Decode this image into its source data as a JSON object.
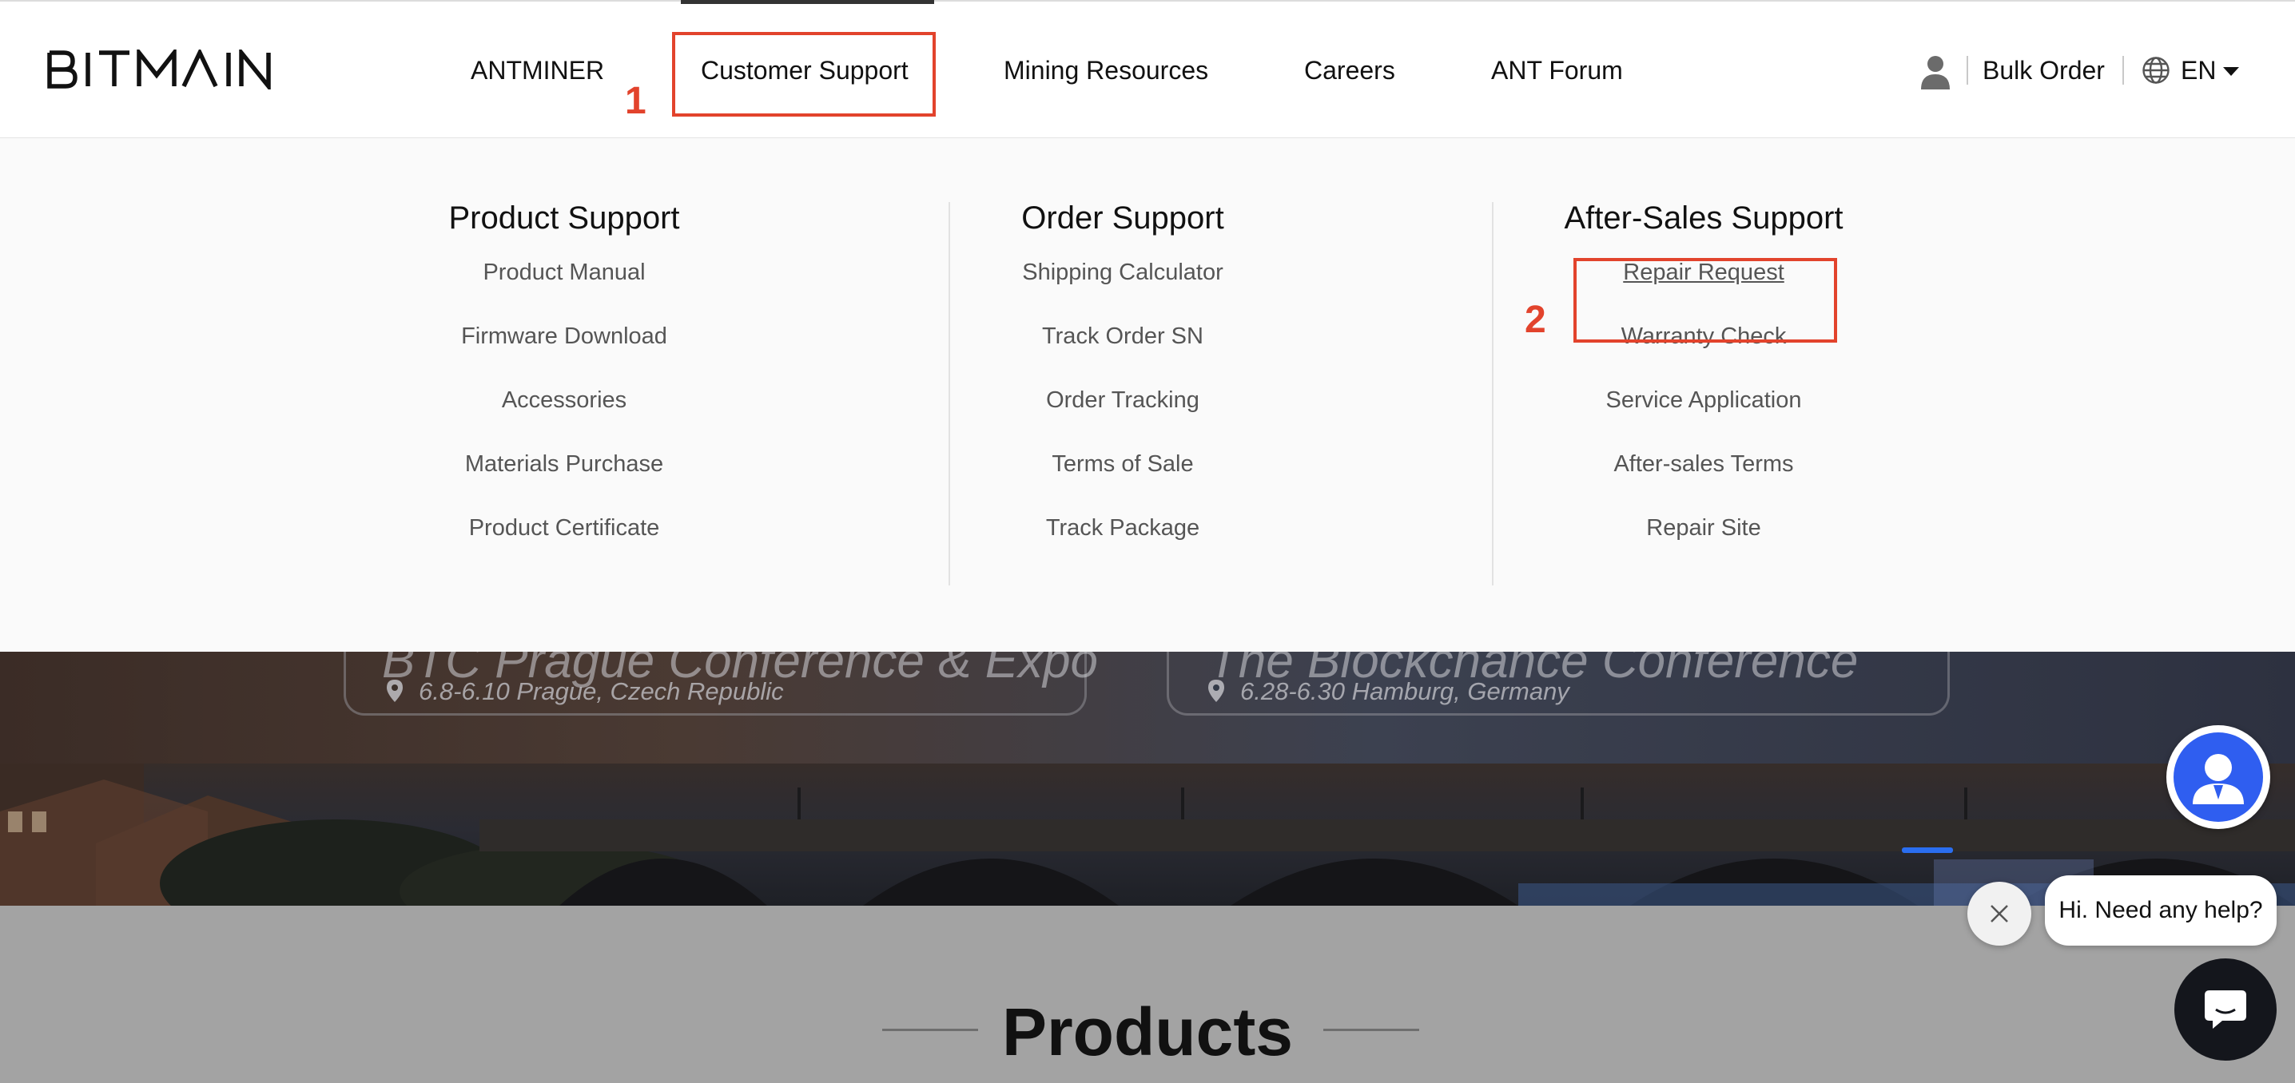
{
  "header": {
    "logo_text": "BITMAIN",
    "nav": [
      {
        "label": "ANTMINER"
      },
      {
        "label": "Customer Support"
      },
      {
        "label": "Mining Resources"
      },
      {
        "label": "Careers"
      },
      {
        "label": "ANT Forum"
      }
    ],
    "bulk_order": "Bulk Order",
    "language": "EN"
  },
  "annotations": {
    "step1": "1",
    "step2": "2"
  },
  "dropdown": {
    "columns": [
      {
        "title": "Product Support",
        "items": [
          "Product Manual",
          "Firmware Download",
          "Accessories",
          "Materials Purchase",
          "Product Certificate"
        ]
      },
      {
        "title": "Order Support",
        "items": [
          "Shipping Calculator",
          "Track Order SN",
          "Order Tracking",
          "Terms of Sale",
          "Track Package"
        ]
      },
      {
        "title": "After-Sales Support",
        "items": [
          "Repair Request",
          "Warranty Check",
          "Service Application",
          "After-sales Terms",
          "Repair Site"
        ]
      }
    ]
  },
  "hero": {
    "event1_title": "BTC Prague Conference & Expo",
    "event1_sub": "6.8-6.10 Prague, Czech Republic",
    "event2_title": "The Blockchance Conference",
    "event2_sub": "6.28-6.30 Hamburg, Germany"
  },
  "products": {
    "title": "Products"
  },
  "chat": {
    "help_text": "Hi. Need any help?"
  },
  "colors": {
    "annotation": "#e2432c",
    "support_blue": "#2f5ef0",
    "slider_active": "#2a6ef0"
  }
}
